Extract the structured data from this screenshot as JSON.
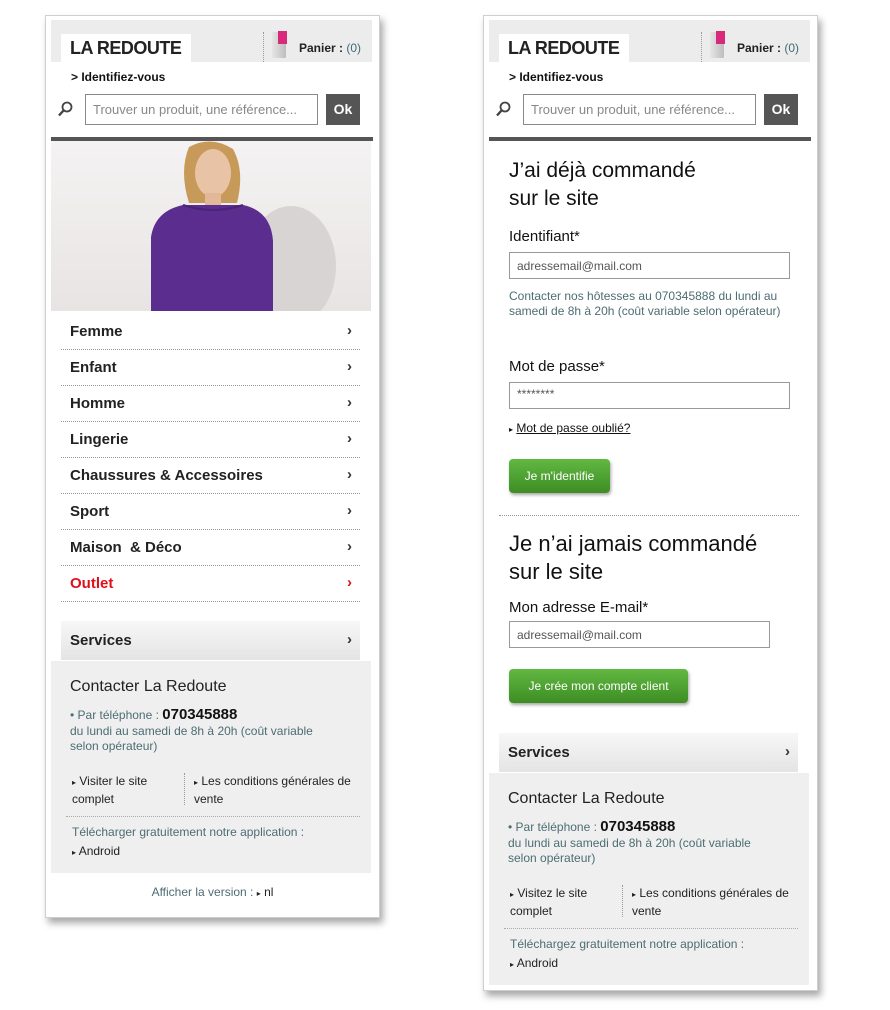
{
  "left": {
    "logo": "LA REDOUTE",
    "cart_label": "Panier :",
    "cart_count": "(0)",
    "login_link": "> Identifiez-vous",
    "search_placeholder": "Trouver un produit, une référence...",
    "search_button": "Ok",
    "nav": [
      {
        "label": "Femme",
        "arrow": "›"
      },
      {
        "label": "Enfant",
        "arrow": "›"
      },
      {
        "label": "Homme",
        "arrow": "›"
      },
      {
        "label": "Lingerie",
        "arrow": "›"
      },
      {
        "label": "Chaussures & Accessoires",
        "arrow": "›"
      },
      {
        "label": "Sport",
        "arrow": "›"
      },
      {
        "label": "Maison  & Déco",
        "arrow": "›"
      },
      {
        "label": "Outlet",
        "arrow": "›"
      }
    ],
    "services": {
      "label": "Services",
      "arrow": "›"
    },
    "contact": {
      "title": "Contacter La Redoute",
      "phone_prefix": "• Par téléphone :",
      "phone_number": "070345888",
      "hours": "du lundi au samedi de 8h à 20h (coût variable selon opérateur)",
      "link_site": "Visiter le site complet",
      "link_cgv": "Les conditions générales de vente",
      "app_text": "Télécharger gratuitement notre application :",
      "android": "Android"
    },
    "footer_prefix": "Afficher la version :",
    "footer_lang": "nl"
  },
  "right": {
    "logo": "LA REDOUTE",
    "cart_label": "Panier :",
    "cart_count": "(0)",
    "login_link": "> Identifiez-vous",
    "search_placeholder": "Trouver un produit, une référence...",
    "search_button": "Ok",
    "login_section": {
      "title_line1": "J’ai déjà commandé",
      "title_line2": "sur le site",
      "id_label": "Identifiant*",
      "id_value": "adressemail@mail.com",
      "help": "Contacter nos hôtesses au 070345888 du lundi au samedi de 8h à 20h (coût variable selon opérateur)",
      "pwd_label": "Mot de passe*",
      "pwd_value": "********",
      "forgot": "Mot de passe oublié?",
      "submit": "Je m'identifie"
    },
    "register_section": {
      "title_line1": "Je n’ai jamais commandé",
      "title_line2": "sur le site",
      "email_label": "Mon adresse E-mail*",
      "email_value": "adressemail@mail.com",
      "submit": "Je crée mon compte client"
    },
    "services": {
      "label": "Services",
      "arrow": "›"
    },
    "contact": {
      "title": "Contacter La Redoute",
      "phone_prefix": "• Par téléphone :",
      "phone_number": "070345888",
      "hours": "du lundi au samedi de 8h à 20h (coût variable selon opérateur)",
      "link_site": "Visitez le site complet",
      "link_cgv": "Les conditions générales de vente",
      "app_text": "Téléchargez gratuitement notre application :",
      "android": "Android"
    }
  },
  "colors": {
    "outlet": "#e0101a",
    "button_green": "#4c9f2f",
    "muted_text": "#4c6d73",
    "dress": "#5b2d8e"
  },
  "icons": [
    "search-icon",
    "shopping-bag-icon",
    "chevron-right-icon",
    "triangle-bullet-icon"
  ]
}
